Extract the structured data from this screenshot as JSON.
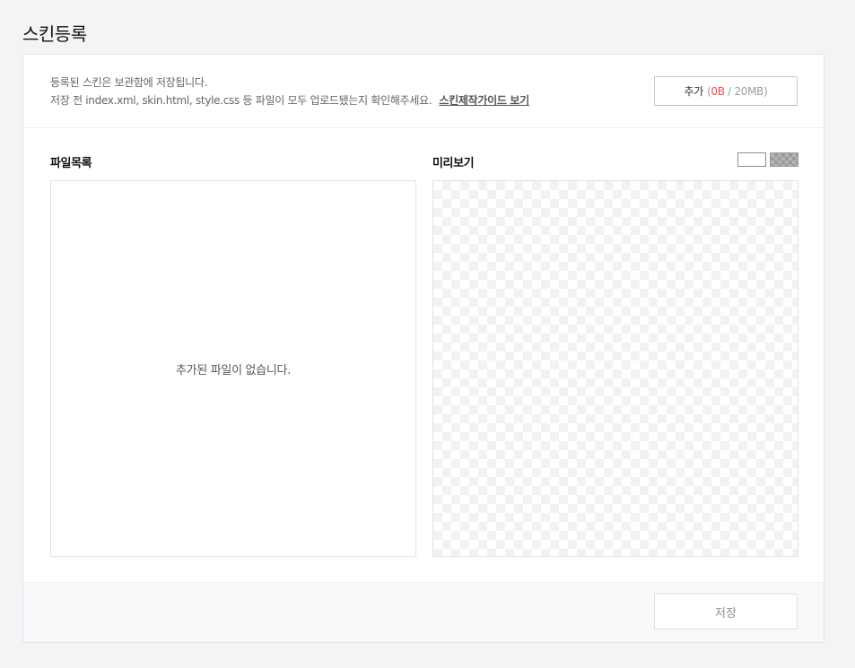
{
  "page": {
    "title": "스킨등록"
  },
  "notice": {
    "line1": "등록된 스킨은 보관함에 저장됩니다.",
    "line2": "저장 전 index.xml, skin.html, style.css 등 파일이 모두 업로드됐는지 확인해주세요.",
    "guide_link": "스킨제작가이드 보기"
  },
  "add_button": {
    "label": "추가",
    "open": "(",
    "used": "0B",
    "separator": "/",
    "limit": "20MB",
    "close": ")"
  },
  "file_list": {
    "label": "파일목록",
    "empty_message": "추가된 파일이 없습니다."
  },
  "preview": {
    "label": "미리보기"
  },
  "footer": {
    "save_label": "저장"
  },
  "colors": {
    "usage_accent": "#f0494d",
    "page_bg": "#f3f4f6"
  }
}
